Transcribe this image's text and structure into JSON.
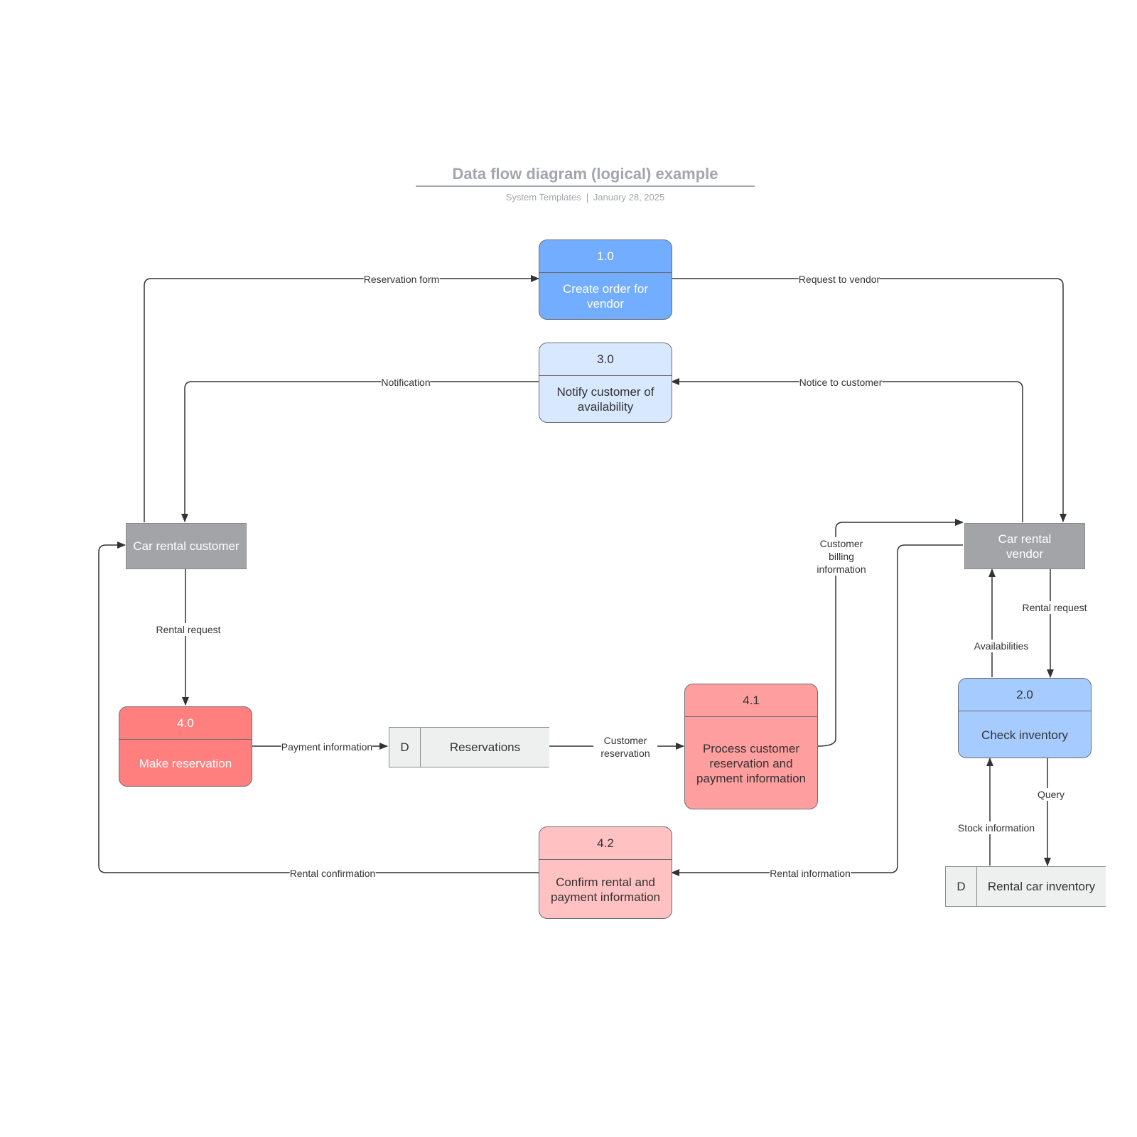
{
  "header": {
    "title": "Data flow diagram (logical) example",
    "author": "System Templates",
    "date": "January 28, 2025"
  },
  "colors": {
    "process_blue": "#72adff",
    "process_light_blue": "#d7e8ff",
    "process_mid_blue": "#a6ccff",
    "process_red": "#ff7f7f",
    "process_salmon": "#ff9e9e",
    "process_pink": "#ffc1c1",
    "entity_gray": "#a3a4a7",
    "store_fill": "#eef0f0",
    "line": "#333333",
    "title_gray": "#a2a6ad"
  },
  "processes": [
    {
      "id": "1.0",
      "label": "Create order for vendor"
    },
    {
      "id": "3.0",
      "label": "Notify customer of availability"
    },
    {
      "id": "4.0",
      "label": "Make reservation"
    },
    {
      "id": "4.1",
      "label": "Process customer reservation and payment information"
    },
    {
      "id": "4.2",
      "label": "Confirm rental and payment information"
    },
    {
      "id": "2.0",
      "label": "Check inventory"
    }
  ],
  "entities": [
    {
      "label": "Car rental customer"
    },
    {
      "label": "Car rental vendor"
    }
  ],
  "stores": [
    {
      "id": "D",
      "label": "Reservations"
    },
    {
      "id": "D",
      "label": "Rental car inventory"
    }
  ],
  "flows": [
    {
      "label": "Reservation form"
    },
    {
      "label": "Request to vendor"
    },
    {
      "label": "Notification"
    },
    {
      "label": "Notice to customer"
    },
    {
      "label": "Rental request"
    },
    {
      "label": "Payment information"
    },
    {
      "label": "Customer reservation"
    },
    {
      "label": "Customer billing information"
    },
    {
      "label": "Rental request"
    },
    {
      "label": "Availabilities"
    },
    {
      "label": "Query"
    },
    {
      "label": "Stock information"
    },
    {
      "label": "Rental information"
    },
    {
      "label": "Rental confirmation"
    }
  ]
}
